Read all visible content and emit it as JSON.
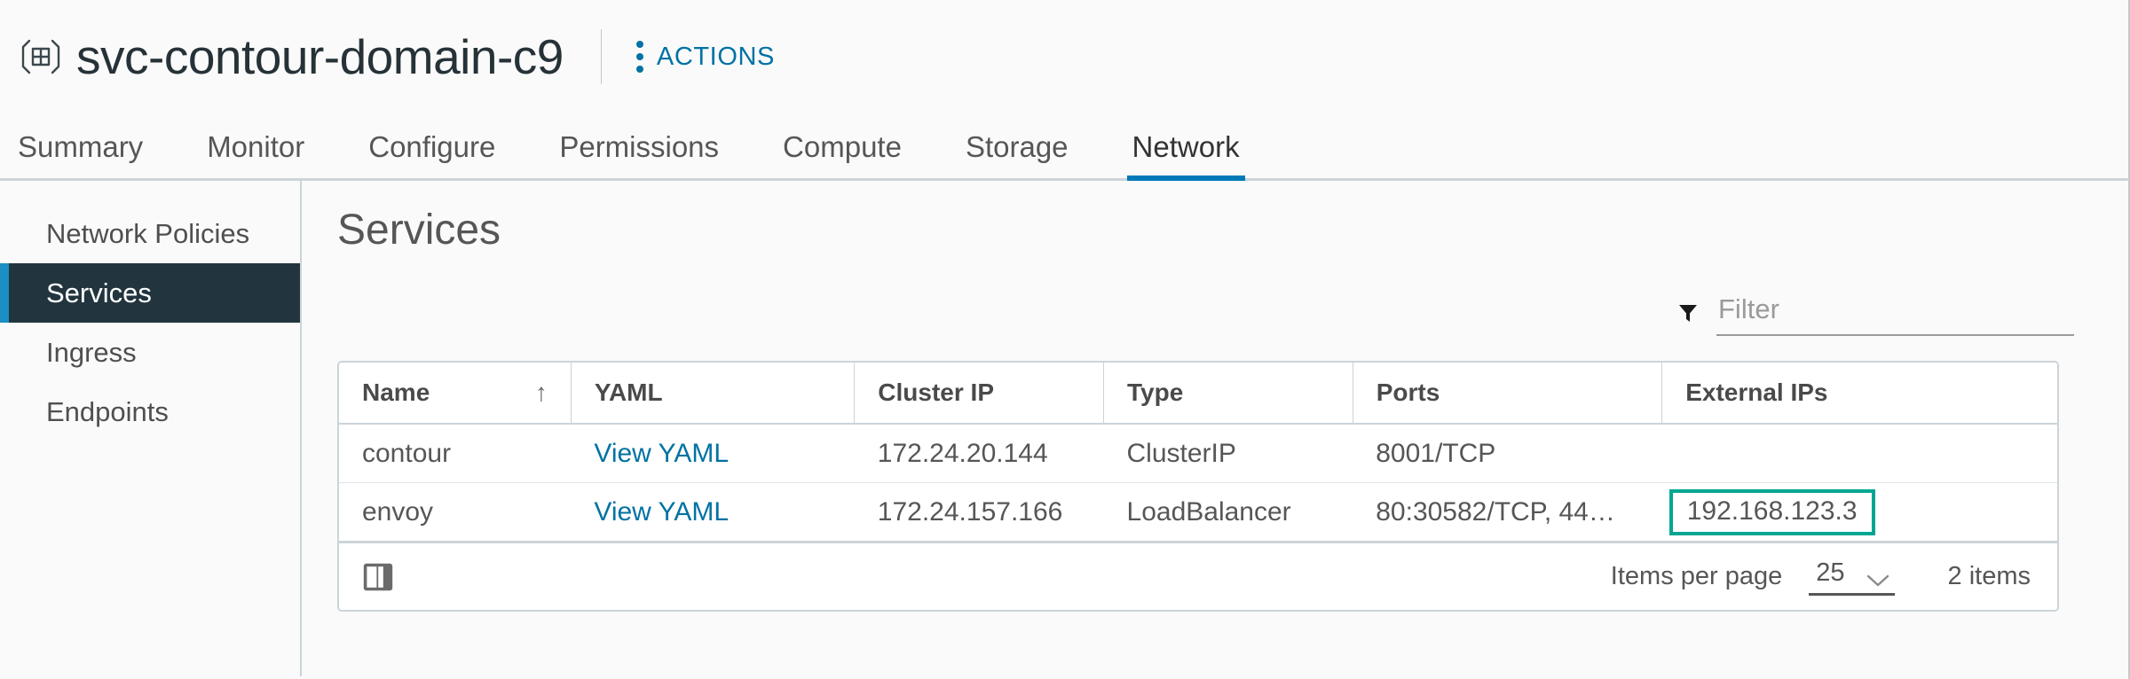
{
  "header": {
    "object_icon": "namespace-grid-icon",
    "title": "svc-contour-domain-c9",
    "actions_label": "ACTIONS",
    "actions_icon": "kebab-menu-icon",
    "accent_blue": "#0072a3"
  },
  "tabs": [
    {
      "label": "Summary",
      "active": false
    },
    {
      "label": "Monitor",
      "active": false
    },
    {
      "label": "Configure",
      "active": false
    },
    {
      "label": "Permissions",
      "active": false
    },
    {
      "label": "Compute",
      "active": false
    },
    {
      "label": "Storage",
      "active": false
    },
    {
      "label": "Network",
      "active": true
    }
  ],
  "sidebar": {
    "items": [
      {
        "label": "Network Policies",
        "selected": false
      },
      {
        "label": "Services",
        "selected": true
      },
      {
        "label": "Ingress",
        "selected": false
      },
      {
        "label": "Endpoints",
        "selected": false
      }
    ],
    "selected_bg": "#22353f",
    "selected_accent": "#1b8ec4"
  },
  "main": {
    "section_title": "Services",
    "filter": {
      "icon": "funnel-icon",
      "placeholder": "Filter",
      "value": ""
    },
    "table": {
      "columns": [
        {
          "label": "Name",
          "sort": "asc"
        },
        {
          "label": "YAML",
          "sort": ""
        },
        {
          "label": "Cluster IP",
          "sort": ""
        },
        {
          "label": "Type",
          "sort": ""
        },
        {
          "label": "Ports",
          "sort": ""
        },
        {
          "label": "External IPs",
          "sort": ""
        }
      ],
      "sort_arrow_glyph": "↑",
      "rows": [
        {
          "name": "contour",
          "yaml": "View YAML",
          "cluster_ip": "172.24.20.144",
          "type": "ClusterIP",
          "ports": "8001/TCP",
          "external_ips": "",
          "highlighted": false
        },
        {
          "name": "envoy",
          "yaml": "View YAML",
          "cluster_ip": "172.24.157.166",
          "type": "LoadBalancer",
          "ports": "80:30582/TCP, 44…",
          "external_ips": "192.168.123.3",
          "highlighted": true
        }
      ],
      "highlight_color": "#00a693"
    },
    "footer": {
      "column_toggle_icon": "column-picker-icon",
      "items_per_page_label": "Items per page",
      "items_per_page_value": "25",
      "chevron_icon": "chevron-down-icon",
      "items_count": "2 items"
    }
  }
}
